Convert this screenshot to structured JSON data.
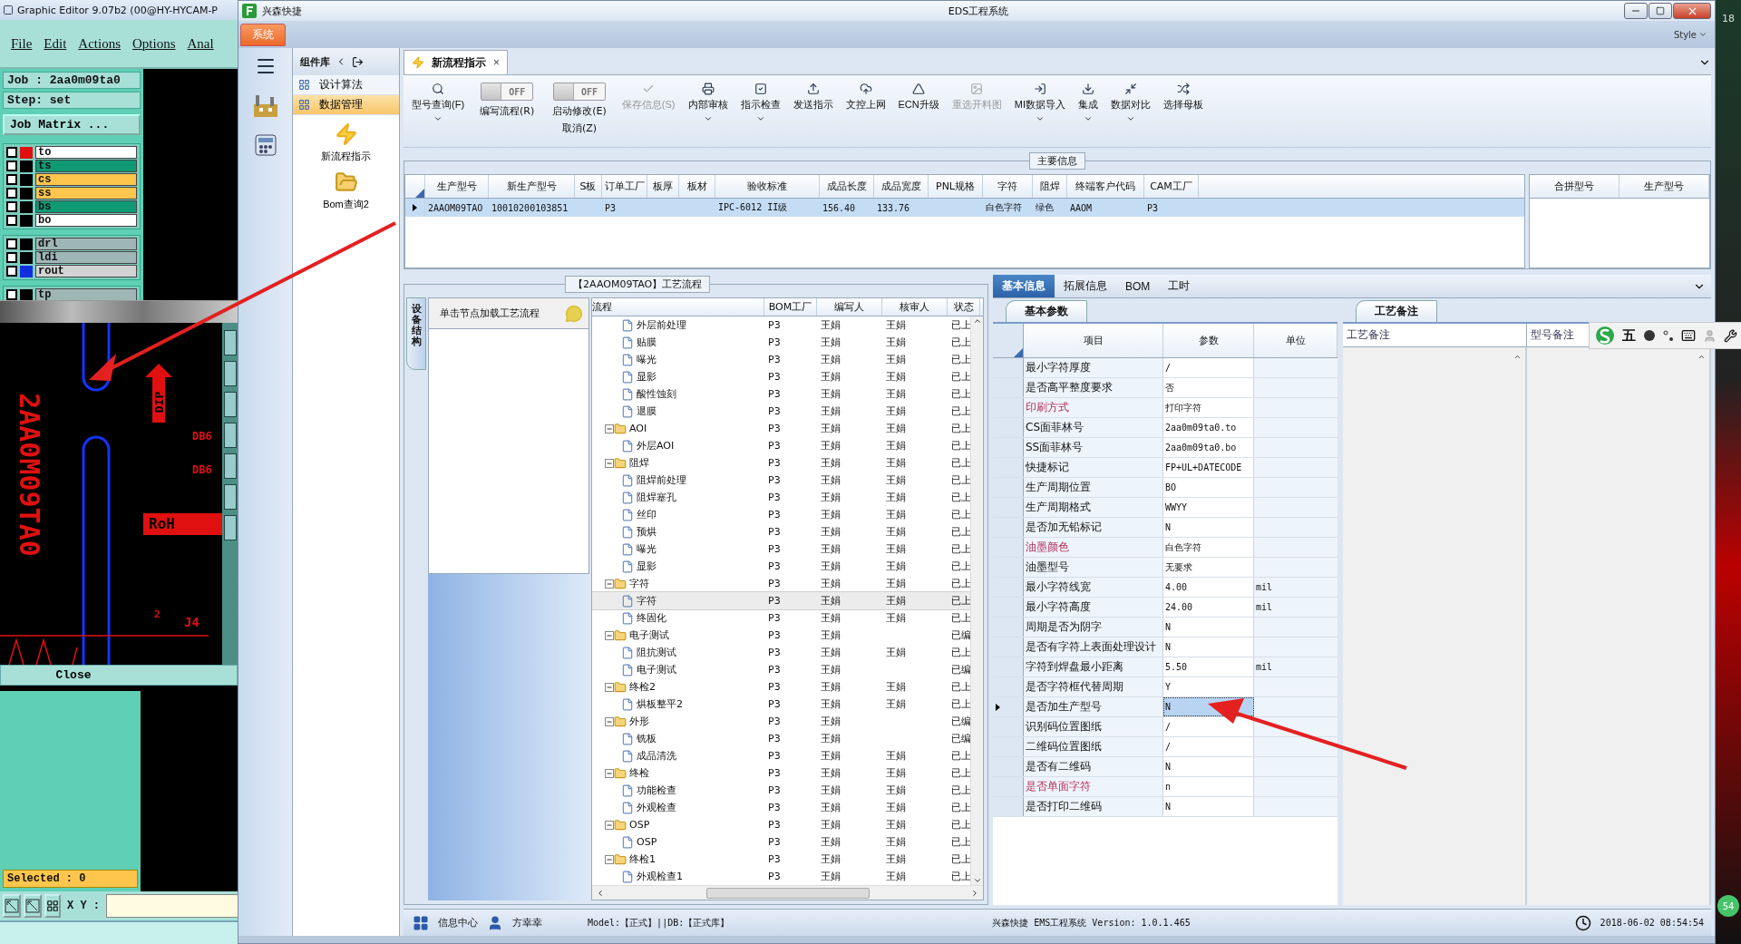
{
  "editor": {
    "title": "Graphic Editor 9.07b2 (00@HY-HYCAM-P",
    "menu": [
      "File",
      "Edit",
      "Actions",
      "Options",
      "Anal"
    ],
    "job": "Job : 2aa0m09ta0",
    "step": "Step: set",
    "matrix_button": "Job Matrix ...",
    "layer_groups": [
      [
        {
          "name": "to",
          "color": "#ffffff",
          "active": true,
          "selected": false,
          "checked": false
        },
        {
          "name": "ts",
          "color": "#0f9a74",
          "active": false,
          "selected": false,
          "checked": false
        },
        {
          "name": "cs",
          "color": "#ffc64d",
          "active": false,
          "selected": false,
          "checked": false
        },
        {
          "name": "ss",
          "color": "#ffc64d",
          "active": false,
          "selected": false,
          "checked": false
        },
        {
          "name": "bs",
          "color": "#0f9a74",
          "active": false,
          "selected": false,
          "checked": false
        },
        {
          "name": "bo",
          "color": "#ffffff",
          "active": false,
          "selected": false,
          "checked": false
        }
      ],
      [
        {
          "name": "drl",
          "color": "#9fb6b6",
          "active": false,
          "selected": false,
          "checked": false
        },
        {
          "name": "ldi",
          "color": "#9fb6b6",
          "active": false,
          "selected": false,
          "checked": false
        },
        {
          "name": "rout",
          "color": "#d4d4d4",
          "active": false,
          "selected": true,
          "checked": false
        }
      ],
      [
        {
          "name": "tp",
          "color": "#9fb6b6",
          "active": false,
          "selected": false,
          "checked": false
        }
      ]
    ],
    "canvas_labels": {
      "part_number": "2AA0M09TA0",
      "dip": "DIP",
      "db_1": "DB6",
      "db_2": "DB6",
      "rohs": "RoH",
      "ref": "J4",
      "pin": "2"
    },
    "close_button": "Close",
    "selected_count": "Selected : 0",
    "xy_label": "X Y :"
  },
  "app": {
    "title": "兴森快捷",
    "center_title": "EDS工程系统",
    "system_tab": "系统",
    "style": "Style"
  },
  "nav_panel": {
    "title": "组件库",
    "items": [
      {
        "label": "设计算法",
        "selected": false
      },
      {
        "label": "数据管理",
        "selected": true
      }
    ],
    "shortcuts": [
      "新流程指示",
      "Bom查询2"
    ]
  },
  "document_tab": {
    "label": "新流程指示",
    "close": "×"
  },
  "toolbar": [
    {
      "kind": "button",
      "label": "型号查询(F)",
      "dropdown": true,
      "disabled": false
    },
    {
      "kind": "toggle",
      "label": "编写流程(R)",
      "switch_text": "OFF",
      "on": false
    },
    {
      "kind": "toggle",
      "label": "启动修改(E)",
      "label_2": "取消(Z)",
      "switch_text": "OFF",
      "on": false
    },
    {
      "kind": "button",
      "label": "保存信息(S)",
      "dropdown": false,
      "disabled": true
    },
    {
      "kind": "button",
      "label": "内部审核",
      "dropdown": true,
      "disabled": false
    },
    {
      "kind": "button",
      "label": "指示检查",
      "dropdown": true,
      "disabled": false
    },
    {
      "kind": "button",
      "label": "发送指示",
      "dropdown": false,
      "disabled": false
    },
    {
      "kind": "button",
      "label": "文控上网",
      "dropdown": false,
      "disabled": false
    },
    {
      "kind": "button",
      "label": "ECN升级",
      "dropdown": false,
      "disabled": false
    },
    {
      "kind": "button",
      "label": "重选开料图",
      "dropdown": false,
      "disabled": true
    },
    {
      "kind": "button",
      "label": "MI数据导入",
      "dropdown": true,
      "disabled": false
    },
    {
      "kind": "button",
      "label": "集成",
      "dropdown": true,
      "disabled": false
    },
    {
      "kind": "button",
      "label": "数据对比",
      "dropdown": true,
      "disabled": false
    },
    {
      "kind": "button",
      "label": "选择母板",
      "dropdown": false,
      "disabled": false
    }
  ],
  "main_info": {
    "title": "主要信息",
    "columns": [
      "生产型号",
      "新生产型号",
      "S板",
      "订单工厂",
      "板厚",
      "板材",
      "验收标准",
      "成品长度",
      "成品宽度",
      "PNL规格",
      "字符",
      "阻焊",
      "终端客户代码",
      "CAM工厂"
    ],
    "rows": [
      {
        "selected": true,
        "cells": [
          "2AAOM09TAO",
          "10010200103851",
          null,
          "P3",
          null,
          null,
          "IPC-6012 II级",
          "156.40",
          "133.76",
          null,
          "白色字符",
          "绿色",
          "AAOM",
          "P3"
        ]
      }
    ],
    "side_columns": [
      "合拼型号",
      "生产型号"
    ]
  },
  "flow": {
    "title": "【2AAOM09TAO】工艺流程",
    "side_tab": "设备结构",
    "hint": "单击节点加载工艺流程",
    "columns": [
      "流程",
      "BOM工厂",
      "编写人",
      "核审人",
      "状态"
    ],
    "tree": [
      {
        "children": [
          {
            "label": "外层前处理",
            "bom": "P3",
            "writer": "王娟",
            "reviewer": "王娟",
            "status": "已上",
            "selected": false
          },
          {
            "label": "贴膜",
            "bom": "P3",
            "writer": "王娟",
            "reviewer": "王娟",
            "status": "已上",
            "selected": false
          },
          {
            "label": "曝光",
            "bom": "P3",
            "writer": "王娟",
            "reviewer": "王娟",
            "status": "已上",
            "selected": false
          },
          {
            "label": "显影",
            "bom": "P3",
            "writer": "王娟",
            "reviewer": "王娟",
            "status": "已上",
            "selected": false
          },
          {
            "label": "酸性蚀刻",
            "bom": "P3",
            "writer": "王娟",
            "reviewer": "王娟",
            "status": "已上",
            "selected": false
          },
          {
            "label": "退膜",
            "bom": "P3",
            "writer": "王娟",
            "reviewer": "王娟",
            "status": "已上",
            "selected": false
          }
        ]
      },
      {
        "label": "AOI",
        "bom": "P3",
        "writer": "王娟",
        "reviewer": "王娟",
        "status": "已上",
        "selected": false,
        "expanded": true,
        "children": [
          {
            "label": "外层AOI",
            "bom": "P3",
            "writer": "王娟",
            "reviewer": "王娟",
            "status": "已上",
            "selected": false
          }
        ]
      },
      {
        "label": "阻焊",
        "bom": "P3",
        "writer": "王娟",
        "reviewer": "王娟",
        "status": "已上",
        "selected": false,
        "expanded": true,
        "children": [
          {
            "label": "阻焊前处理",
            "bom": "P3",
            "writer": "王娟",
            "reviewer": "王娟",
            "status": "已上",
            "selected": false
          },
          {
            "label": "阻焊塞孔",
            "bom": "P3",
            "writer": "王娟",
            "reviewer": "王娟",
            "status": "已上",
            "selected": false
          },
          {
            "label": "丝印",
            "bom": "P3",
            "writer": "王娟",
            "reviewer": "王娟",
            "status": "已上",
            "selected": false
          },
          {
            "label": "预烘",
            "bom": "P3",
            "writer": "王娟",
            "reviewer": "王娟",
            "status": "已上",
            "selected": false
          },
          {
            "label": "曝光",
            "bom": "P3",
            "writer": "王娟",
            "reviewer": "王娟",
            "status": "已上",
            "selected": false
          },
          {
            "label": "显影",
            "bom": "P3",
            "writer": "王娟",
            "reviewer": "王娟",
            "status": "已上",
            "selected": false
          }
        ]
      },
      {
        "label": "字符",
        "bom": "P3",
        "writer": "王娟",
        "reviewer": "王娟",
        "status": "已上",
        "selected": false,
        "expanded": true,
        "children": [
          {
            "label": "字符",
            "bom": "P3",
            "writer": "王娟",
            "reviewer": "王娟",
            "status": "已上",
            "selected": true
          },
          {
            "label": "终固化",
            "bom": "P3",
            "writer": "王娟",
            "reviewer": "王娟",
            "status": "已上",
            "selected": false
          }
        ]
      },
      {
        "label": "电子测试",
        "bom": "P3",
        "writer": "王娟",
        "status": "已编",
        "selected": false,
        "expanded": true,
        "children": [
          {
            "label": "阻抗测试",
            "bom": "P3",
            "writer": "王娟",
            "reviewer": "王娟",
            "status": "已上",
            "selected": false
          },
          {
            "label": "电子测试",
            "bom": "P3",
            "writer": "王娟",
            "status": "已编",
            "selected": false
          }
        ]
      },
      {
        "label": "终检2",
        "bom": "P3",
        "writer": "王娟",
        "reviewer": "王娟",
        "status": "已上",
        "selected": false,
        "expanded": true,
        "children": [
          {
            "label": "烘板整平2",
            "bom": "P3",
            "writer": "王娟",
            "reviewer": "王娟",
            "status": "已上",
            "selected": false
          }
        ]
      },
      {
        "label": "外形",
        "bom": "P3",
        "writer": "王娟",
        "status": "已编",
        "selected": false,
        "expanded": true,
        "children": [
          {
            "label": "铣板",
            "bom": "P3",
            "writer": "王娟",
            "status": "已编",
            "selected": false
          },
          {
            "label": "成品清洗",
            "bom": "P3",
            "writer": "王娟",
            "reviewer": "王娟",
            "status": "已上",
            "selected": false
          }
        ]
      },
      {
        "label": "终检",
        "bom": "P3",
        "writer": "王娟",
        "reviewer": "王娟",
        "status": "已上",
        "selected": false,
        "expanded": true,
        "children": [
          {
            "label": "功能检查",
            "bom": "P3",
            "writer": "王娟",
            "reviewer": "王娟",
            "status": "已上",
            "selected": false
          },
          {
            "label": "外观检查",
            "bom": "P3",
            "writer": "王娟",
            "reviewer": "王娟",
            "status": "已上",
            "selected": false
          }
        ]
      },
      {
        "label": "OSP",
        "bom": "P3",
        "writer": "王娟",
        "reviewer": "王娟",
        "status": "已上",
        "selected": false,
        "expanded": true,
        "children": [
          {
            "label": "OSP",
            "bom": "P3",
            "writer": "王娟",
            "reviewer": "王娟",
            "status": "已上",
            "selected": false
          }
        ]
      },
      {
        "label": "终检1",
        "bom": "P3",
        "writer": "王娟",
        "reviewer": "王娟",
        "status": "已上",
        "selected": false,
        "expanded": true,
        "children": [
          {
            "label": "外观检查1",
            "bom": "P3",
            "writer": "王娟",
            "reviewer": "王娟",
            "status": "已上",
            "selected": false
          }
        ]
      }
    ]
  },
  "details": {
    "tabs": [
      {
        "label": "基本信息",
        "selected": true
      },
      {
        "label": "拓展信息",
        "selected": false
      },
      {
        "label": "BOM",
        "selected": false
      },
      {
        "label": "工时",
        "selected": false
      }
    ],
    "panel_tab": "基本参数",
    "columns": [
      "项目",
      "参数",
      "单位"
    ],
    "rows": [
      {
        "item": "最小字符厚度",
        "value": "/",
        "emphasized": false,
        "current": false
      },
      {
        "item": "是否高平整度要求",
        "value": "否",
        "emphasized": false,
        "current": false
      },
      {
        "item": "印刷方式",
        "value": "打印字符",
        "emphasized": true,
        "current": false
      },
      {
        "item": "CS面菲林号",
        "value": "2aa0m09ta0.to",
        "emphasized": false,
        "current": false
      },
      {
        "item": "SS面菲林号",
        "value": "2aa0m09ta0.bo",
        "emphasized": false,
        "current": false
      },
      {
        "item": "快捷标记",
        "value": "FP+UL+DATECODE",
        "emphasized": false,
        "current": false
      },
      {
        "item": "生产周期位置",
        "value": "BO",
        "emphasized": false,
        "current": false
      },
      {
        "item": "生产周期格式",
        "value": "WWYY",
        "emphasized": false,
        "current": false
      },
      {
        "item": "是否加无铅标记",
        "value": "N",
        "emphasized": false,
        "current": false
      },
      {
        "item": "油墨颜色",
        "value": "白色字符",
        "emphasized": true,
        "current": false
      },
      {
        "item": "油墨型号",
        "value": "无要求",
        "emphasized": false,
        "current": false
      },
      {
        "item": "最小字符线宽",
        "value": "4.00",
        "unit": "mil",
        "emphasized": false,
        "current": false
      },
      {
        "item": "最小字符高度",
        "value": "24.00",
        "unit": "mil",
        "emphasized": false,
        "current": false
      },
      {
        "item": "周期是否为阴字",
        "value": "N",
        "emphasized": false,
        "current": false
      },
      {
        "item": "是否有字符上表面处理设计",
        "value": "N",
        "emphasized": false,
        "current": false
      },
      {
        "item": "字符到焊盘最小距离",
        "value": "5.50",
        "unit": "mil",
        "emphasized": false,
        "current": false
      },
      {
        "item": "是否字符框代替周期",
        "value": "Y",
        "emphasized": false,
        "current": false
      },
      {
        "item": "是否加生产型号",
        "value": "N",
        "emphasized": false,
        "current": true
      },
      {
        "item": "识别码位置图纸",
        "value": "/",
        "emphasized": false,
        "current": false
      },
      {
        "item": "二维码位置图纸",
        "value": "/",
        "emphasized": false,
        "current": false
      },
      {
        "item": "是否有二维码",
        "value": "N",
        "emphasized": false,
        "current": false
      },
      {
        "item": "是否单面字符",
        "value": "n",
        "emphasized": true,
        "current": false
      },
      {
        "item": "是否打印二维码",
        "value": "N",
        "emphasized": false,
        "current": false
      }
    ],
    "notes": {
      "tab": "工艺备注",
      "columns": [
        "工艺备注",
        "型号备注"
      ]
    }
  },
  "ime_bar": {
    "mode": "五"
  },
  "desktop": {
    "top_text": "18",
    "badge": "54"
  },
  "status_bar": {
    "info_center": "信息中心",
    "user": "方幸幸",
    "model": "Model:【正式】||DB:【正式库】",
    "version": "兴森快捷 EMS工程系统 Version: 1.0.1.465",
    "time": "2018-06-02 08:54:54"
  }
}
